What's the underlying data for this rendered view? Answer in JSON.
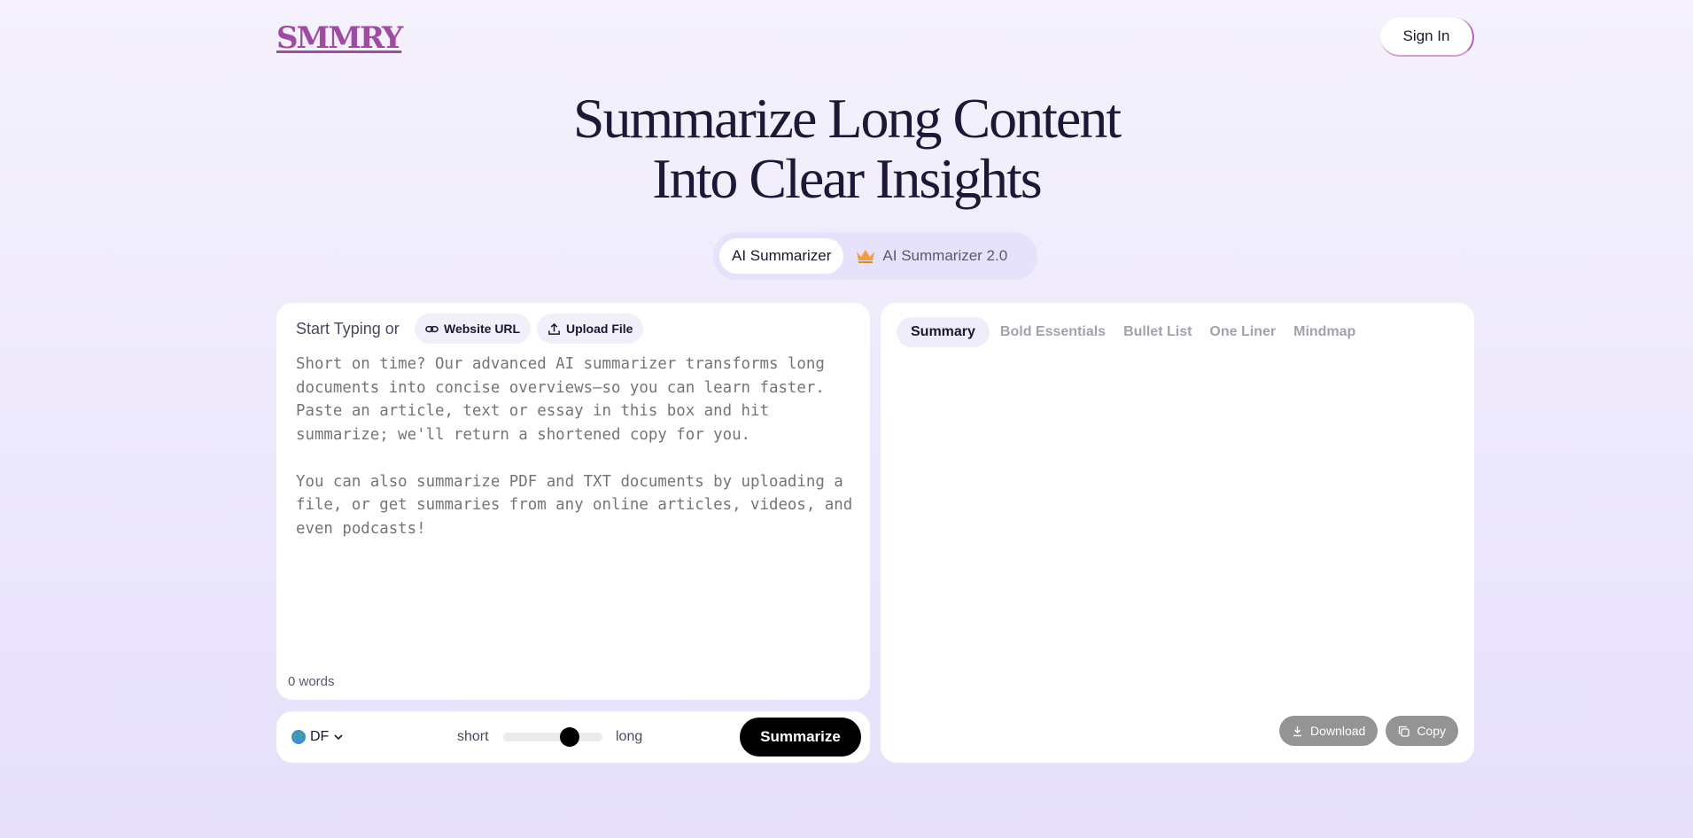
{
  "header": {
    "logo": "SMMRY",
    "sign_in": "Sign In"
  },
  "hero": {
    "line1": "Summarize Long Content",
    "line2": "Into Clear Insights"
  },
  "modes": [
    {
      "label": "AI Summarizer",
      "active": true
    },
    {
      "label": "AI Summarizer 2.0",
      "active": false,
      "icon": "crown-icon"
    }
  ],
  "input": {
    "start_label": "Start Typing or",
    "website_url": "Website URL",
    "upload_file": "Upload File",
    "placeholder": "Short on time? Our advanced AI summarizer transforms long documents into concise overviews—so you can learn faster. Paste an article, text or essay in this box and hit summarize; we'll return a shortened copy for you.\n\nYou can also summarize PDF and TXT documents by uploading a file, or get summaries from any online articles, videos, and even podcasts!",
    "word_count": "0 words"
  },
  "controls": {
    "language": "DF",
    "language_icon": "globe-icon",
    "short_label": "short",
    "long_label": "long",
    "length_level": 0.67,
    "summarize": "Summarize"
  },
  "output": {
    "tabs": [
      "Summary",
      "Bold Essentials",
      "Bullet List",
      "One Liner",
      "Mindmap"
    ],
    "active_tab": "Summary",
    "download": "Download",
    "copy": "Copy"
  },
  "colors": {
    "logo": "#a04ba3",
    "primary_button": "#000000",
    "disabled_button": "#949494",
    "crown": "#f0a03a"
  }
}
